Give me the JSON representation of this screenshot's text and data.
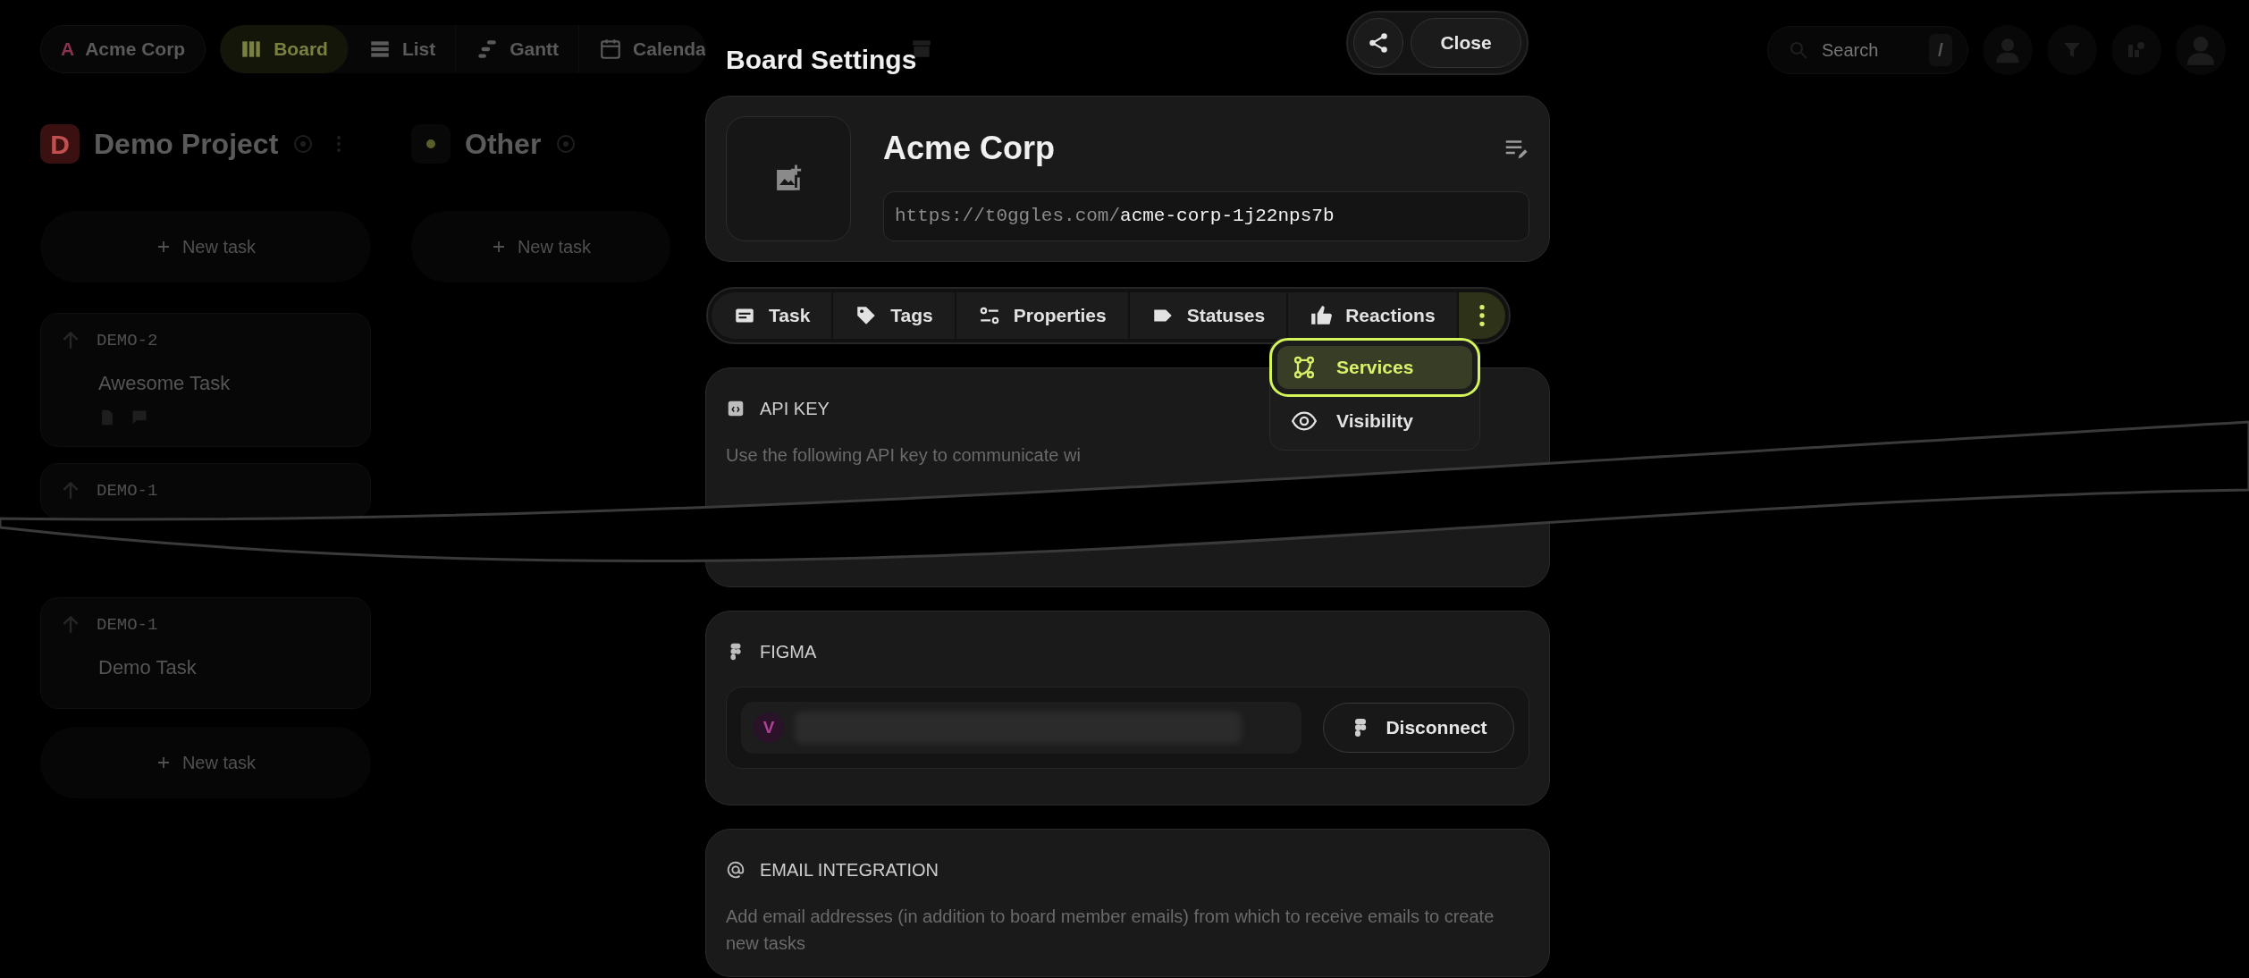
{
  "background": {
    "workspace": {
      "initial": "A",
      "name": "Acme Corp",
      "color": "#8a3050"
    },
    "views": [
      {
        "label": "Board",
        "selected": true
      },
      {
        "label": "List",
        "selected": false
      },
      {
        "label": "Gantt",
        "selected": false
      },
      {
        "label": "Calenda",
        "selected": false
      }
    ],
    "search": {
      "placeholder": "Search",
      "shortcut": "/"
    },
    "columns": [
      {
        "initial": "D",
        "title": "Demo Project",
        "color": "#3a1010",
        "new_task": "New task",
        "cards": [
          {
            "id": "DEMO-2",
            "title": "Awesome Task",
            "attachments": true
          },
          {
            "id": "DEMO-1"
          },
          {
            "id": "DEMO-1",
            "title": "Demo Task",
            "attachments": false
          }
        ],
        "new_task_bottom": "New task"
      },
      {
        "title": "Other",
        "color": "#5a5e2a",
        "new_task": "New task"
      }
    ]
  },
  "modal": {
    "title": "Board Settings",
    "close": "Close",
    "board": {
      "name": "Acme Corp",
      "url_prefix": "https://t0ggles.com/",
      "url_slug": "acme-corp-1j22nps7b"
    },
    "tabs": [
      {
        "label": "Task",
        "selected": false
      },
      {
        "label": "Tags",
        "selected": false
      },
      {
        "label": "Properties",
        "selected": false
      },
      {
        "label": "Statuses",
        "selected": false
      },
      {
        "label": "Reactions",
        "selected": false
      }
    ],
    "menu": [
      {
        "label": "Services",
        "selected": true
      },
      {
        "label": "Visibility",
        "selected": false
      }
    ],
    "sections": [
      {
        "kind": "api",
        "title": "API KEY",
        "text": "Use the following API key to communicate wi"
      },
      {
        "kind": "figma",
        "title": "FIGMA",
        "avatar": "V",
        "button": "Disconnect"
      },
      {
        "kind": "email",
        "title": "EMAIL INTEGRATION",
        "text": "Add email addresses (in addition to board member emails) from which to receive emails to create new tasks"
      }
    ]
  }
}
